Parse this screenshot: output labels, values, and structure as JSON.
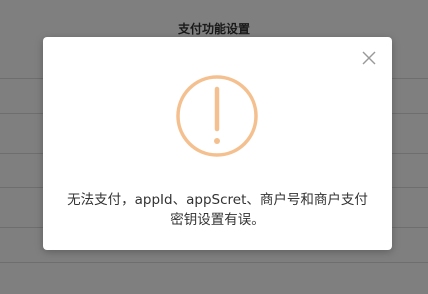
{
  "page": {
    "title": "支付功能设置"
  },
  "dialog": {
    "icon": "exclamation-circle-icon",
    "close_icon": "close-icon",
    "message_line1": "无法支付，appId、appScret、商户号和商户支付",
    "message_line2": "密钥设置有误。"
  },
  "colors": {
    "overlay": "rgba(0,0,0,0.5)",
    "warning": "#f5c08f",
    "close": "#999999",
    "text": "#333333"
  }
}
